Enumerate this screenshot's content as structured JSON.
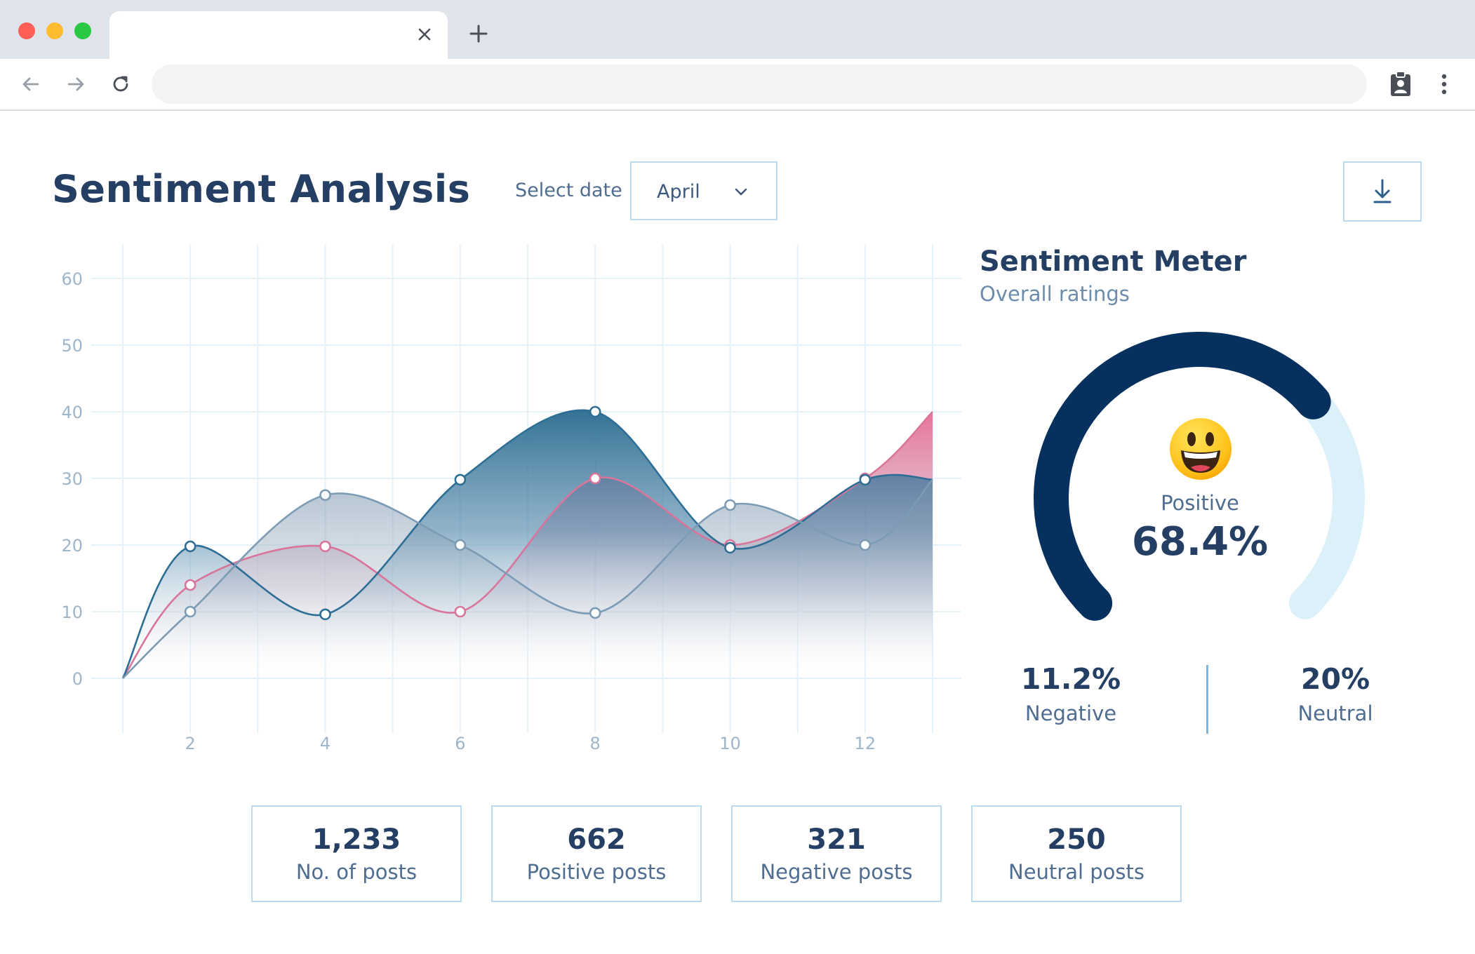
{
  "browser": {
    "tab_title": "",
    "url": "",
    "traffic_colors": {
      "close": "#ff5f57",
      "minimize": "#febc2e",
      "maximize": "#28c840"
    },
    "icons": [
      "close-icon",
      "plus-icon",
      "back-arrow-icon",
      "forward-arrow-icon",
      "reload-icon",
      "clipboard-user-icon",
      "kebab-menu-icon"
    ]
  },
  "header": {
    "title": "Sentiment Analysis",
    "select_label": "Select date",
    "selected_date": "April",
    "download_icon": "download-icon"
  },
  "chart_data": {
    "type": "area",
    "x": [
      1,
      2,
      3,
      4,
      5,
      6,
      7,
      8,
      9,
      10,
      11,
      12,
      13
    ],
    "series": [
      {
        "color": "#2e6e95",
        "values": [
          0,
          19.8,
          null,
          9.6,
          null,
          29.8,
          null,
          40,
          null,
          19.6,
          null,
          29.8,
          29.8
        ]
      },
      {
        "color": "#d9759a",
        "values": [
          0,
          14,
          null,
          19.8,
          null,
          10,
          null,
          30,
          null,
          20,
          null,
          30,
          40
        ]
      },
      {
        "color": "#7c9bb4",
        "values": [
          0,
          10,
          null,
          27.5,
          null,
          20,
          null,
          9.8,
          null,
          26,
          null,
          20,
          29.8
        ]
      }
    ],
    "xticks": [
      2,
      4,
      6,
      8,
      10,
      12
    ],
    "yticks": [
      0,
      10,
      20,
      30,
      40,
      50,
      60
    ],
    "xlim": [
      1,
      13.4
    ],
    "ylim": [
      0,
      60
    ],
    "grid": true,
    "title": "",
    "xlabel": "",
    "ylabel": ""
  },
  "meter": {
    "title": "Sentiment Meter",
    "subtitle": "Overall ratings",
    "emoji": "grinning-face-icon",
    "positive_label": "Positive",
    "positive_value": "68.4%",
    "positive_fraction": 0.684,
    "negative_value": "11.2%",
    "negative_label": "Negative",
    "neutral_value": "20%",
    "neutral_label": "Neutral",
    "colors": {
      "filled": "#06305e",
      "track": "#dbf0f8"
    }
  },
  "stats": [
    {
      "value": "1,233",
      "label": "No. of posts"
    },
    {
      "value": "662",
      "label": "Positive posts"
    },
    {
      "value": "321",
      "label": "Negative posts"
    },
    {
      "value": "250",
      "label": "Neutral posts"
    }
  ]
}
